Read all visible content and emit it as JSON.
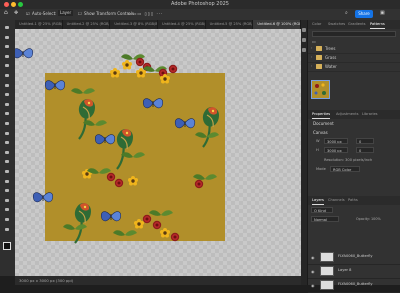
{
  "app": {
    "title": "Adobe Photoshop 2025"
  },
  "options_bar": {
    "auto_select_label": "Auto-Select:",
    "auto_select_value": "Layer",
    "transform_label": "Show Transform Controls",
    "share_label": "Share"
  },
  "tabs": [
    {
      "label": "Untitled-1 @ 25% (RGB/8)",
      "active": false
    },
    {
      "label": "Untitled-2 @ 25% (RGB/8)",
      "active": false
    },
    {
      "label": "Untitled-3 @ 8% (RGB/8)",
      "active": false
    },
    {
      "label": "Untitled-4 @ 25% (RGB/8)",
      "active": false
    },
    {
      "label": "Untitled-5 @ 25% (RGB/8)",
      "active": false
    },
    {
      "label": "Untitled-6 @ 100% (RGB/8)",
      "active": true
    }
  ],
  "status": {
    "info": "3000 px x 3000 px (300 ppi)"
  },
  "swatch_panel": {
    "tabs": [
      "Color",
      "Swatches",
      "Gradients",
      "Patterns"
    ],
    "active_tab": "Patterns",
    "folders": [
      "Trees",
      "Grass",
      "Water"
    ]
  },
  "properties_panel": {
    "tabs": [
      "Properties",
      "Adjustments",
      "Libraries"
    ],
    "doc_label": "Document",
    "canvas_label": "Canvas",
    "width_label": "W",
    "width_value": "3000 px",
    "x_value": "0",
    "height_label": "H",
    "height_value": "3000 px",
    "y_value": "0",
    "resolution_text": "Resolution: 300 pixels/inch",
    "mode_label": "Mode",
    "mode_value": "RGB Color"
  },
  "layers_panel": {
    "tabs": [
      "Layers",
      "Channels",
      "Paths"
    ],
    "kind_label": "Q Kind",
    "blend_mode": "Normal",
    "opacity": "Opacity: 100%",
    "layers": [
      {
        "name": "FLYA0060_Butterfly"
      },
      {
        "name": "Layer 8"
      },
      {
        "name": "FLYA0060_Butterfly"
      }
    ]
  },
  "colors": {
    "pattern_background": "#b18f2a",
    "accent": "#1473e6"
  }
}
